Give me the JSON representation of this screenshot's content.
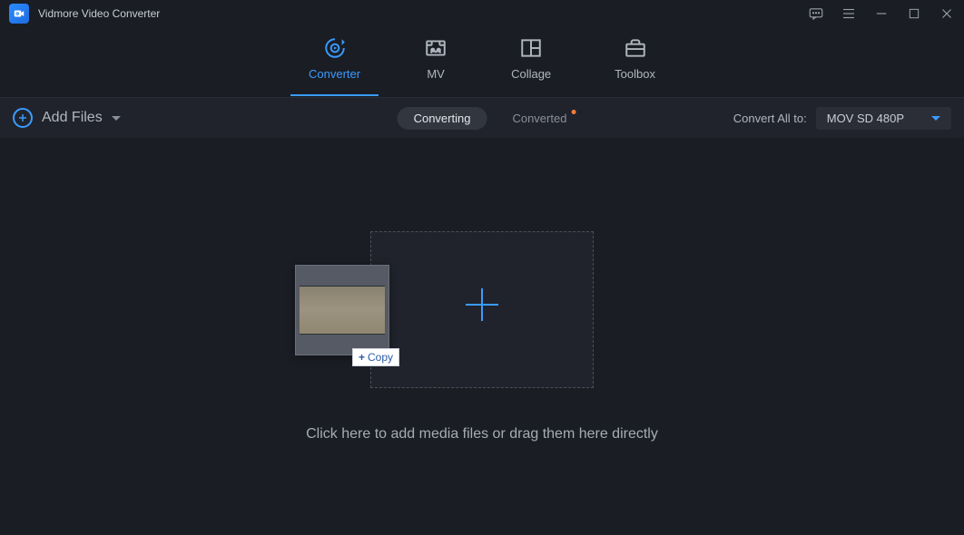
{
  "app": {
    "title": "Vidmore Video Converter"
  },
  "nav": {
    "items": [
      {
        "label": "Converter"
      },
      {
        "label": "MV"
      },
      {
        "label": "Collage"
      },
      {
        "label": "Toolbox"
      }
    ]
  },
  "toolbar": {
    "add_files_label": "Add Files",
    "converting_label": "Converting",
    "converted_label": "Converted",
    "convert_all_to_label": "Convert All to:",
    "format_selected": "MOV SD 480P"
  },
  "drop": {
    "copy_badge": "Copy",
    "hint": "Click here to add media files or drag them here directly"
  }
}
